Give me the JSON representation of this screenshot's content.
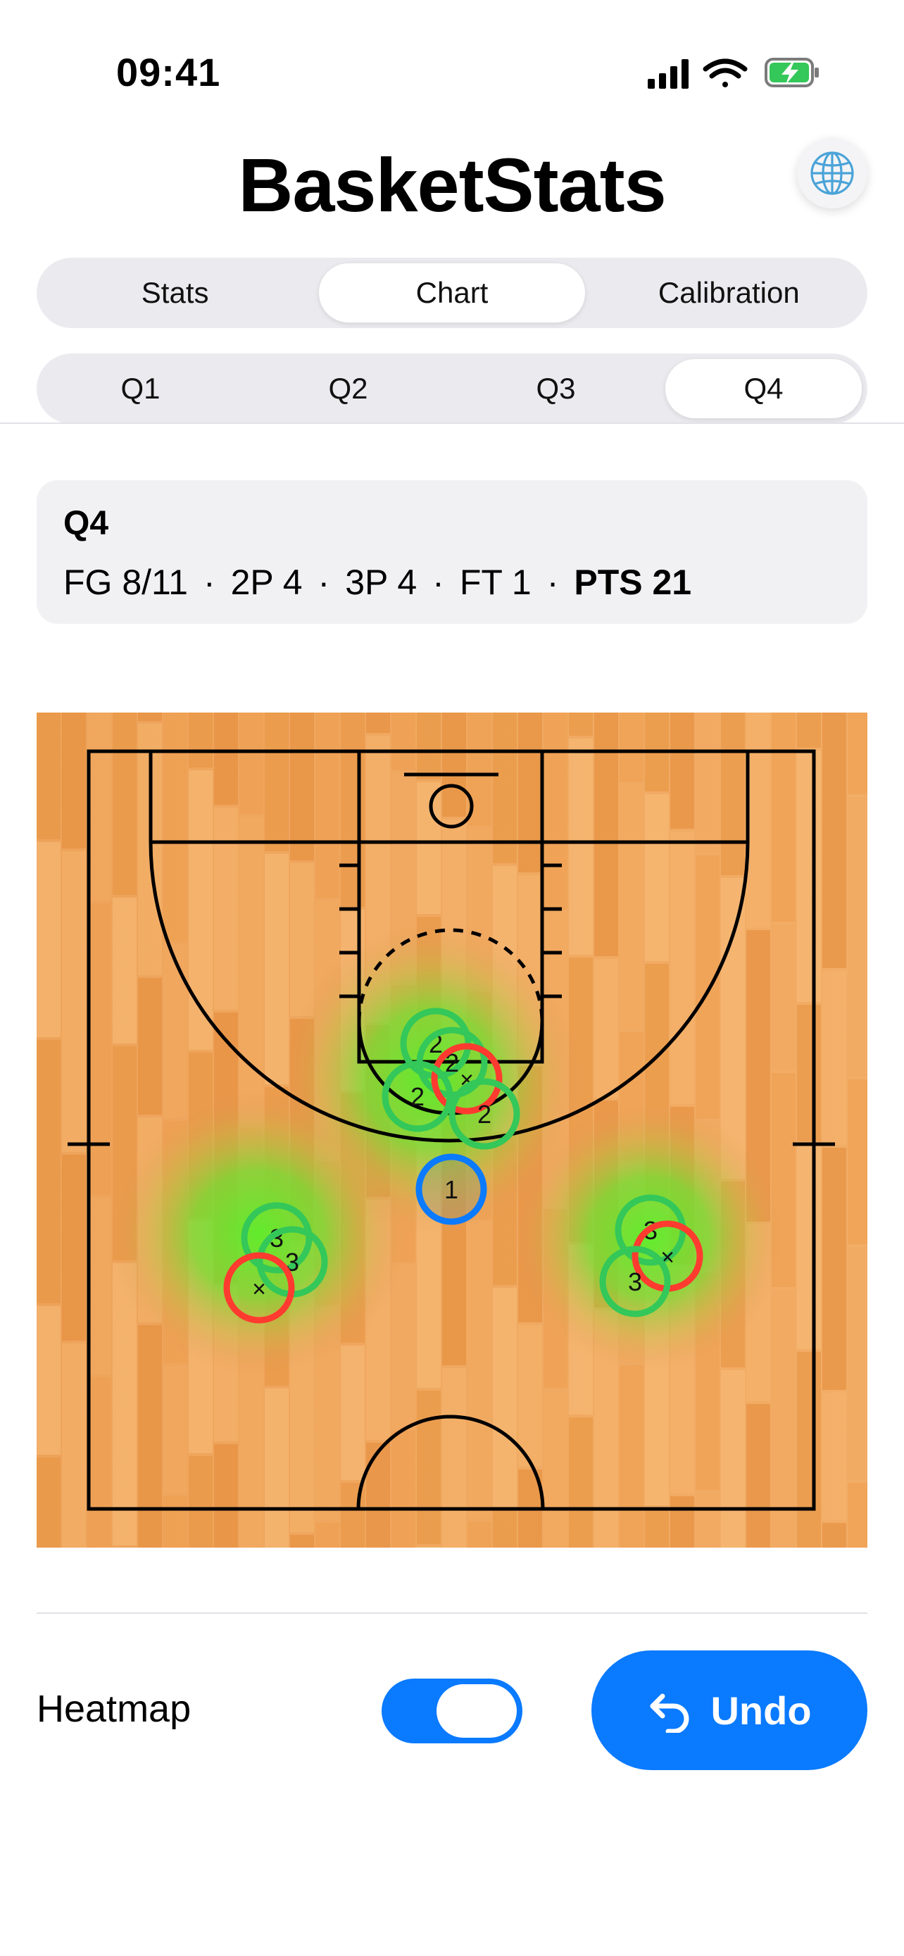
{
  "status": {
    "time": "09:41"
  },
  "header": {
    "title": "BasketStats",
    "globe_icon": "globe-icon"
  },
  "view_tabs": [
    {
      "label": "Stats",
      "active": false
    },
    {
      "label": "Chart",
      "active": true
    },
    {
      "label": "Calibration",
      "active": false
    }
  ],
  "quarter_tabs": [
    {
      "label": "Q1",
      "active": false
    },
    {
      "label": "Q2",
      "active": false
    },
    {
      "label": "Q3",
      "active": false
    },
    {
      "label": "Q4",
      "active": true
    }
  ],
  "summary": {
    "quarter": "Q4",
    "fg": "FG 8/11",
    "two_pt": "2P 4",
    "three_pt": "3P 4",
    "ft": "FT 1",
    "pts": "PTS 21",
    "separator": "·"
  },
  "shots": [
    {
      "label": "2",
      "made": true,
      "type": "2pt"
    },
    {
      "label": "2",
      "made": true,
      "type": "2pt"
    },
    {
      "label": "×",
      "made": false,
      "type": "2pt"
    },
    {
      "label": "2",
      "made": true,
      "type": "2pt"
    },
    {
      "label": "2",
      "made": true,
      "type": "2pt"
    },
    {
      "label": "1",
      "made": true,
      "type": "ft"
    },
    {
      "label": "3",
      "made": true,
      "type": "3pt"
    },
    {
      "label": "3",
      "made": true,
      "type": "3pt"
    },
    {
      "label": "×",
      "made": false,
      "type": "3pt"
    },
    {
      "label": "3",
      "made": true,
      "type": "3pt"
    },
    {
      "label": "×",
      "made": false,
      "type": "3pt"
    },
    {
      "label": "3",
      "made": true,
      "type": "3pt"
    }
  ],
  "colors": {
    "made": "#34c759",
    "missed": "#ff3b30",
    "ft": "#0a7aff",
    "accent": "#0a7aff"
  },
  "controls": {
    "heatmap_label": "Heatmap",
    "heatmap_on": true,
    "undo_label": "Undo",
    "undo_icon": "undo-arrow-icon"
  }
}
